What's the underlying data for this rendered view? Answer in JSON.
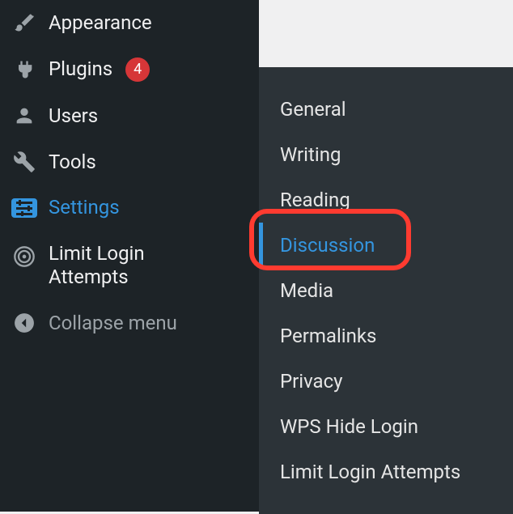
{
  "sidebar": {
    "items": [
      {
        "label": "Appearance",
        "icon": "brush"
      },
      {
        "label": "Plugins",
        "icon": "plug",
        "badge": "4"
      },
      {
        "label": "Users",
        "icon": "user"
      },
      {
        "label": "Tools",
        "icon": "wrench"
      },
      {
        "label": "Settings",
        "icon": "sliders",
        "active": true
      },
      {
        "label": "Limit Login Attempts",
        "icon": "target"
      }
    ],
    "collapse_label": "Collapse menu"
  },
  "submenu": {
    "items": [
      {
        "label": "General"
      },
      {
        "label": "Writing"
      },
      {
        "label": "Reading"
      },
      {
        "label": "Discussion",
        "current": true
      },
      {
        "label": "Media"
      },
      {
        "label": "Permalinks"
      },
      {
        "label": "Privacy"
      },
      {
        "label": "WPS Hide Login"
      },
      {
        "label": "Limit Login Attempts"
      }
    ]
  },
  "highlight": {
    "color": "#ff3b30"
  }
}
